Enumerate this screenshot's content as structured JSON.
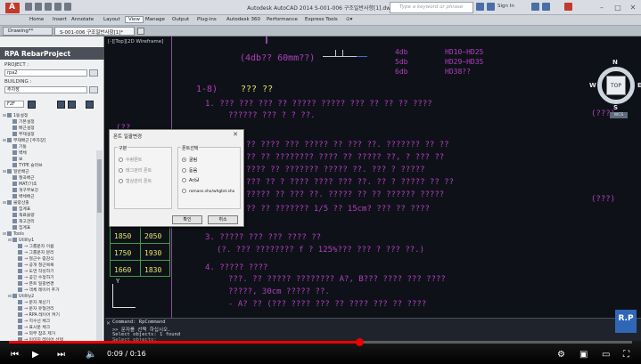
{
  "window": {
    "title": "Autodesk AutoCAD 2014    S-001-006 구조일반사항[1].dwg",
    "search_placeholder": "Type a keyword or phrase",
    "sign_in": "Sign In"
  },
  "ribbon_tabs": [
    "Home",
    "Insert",
    "Annotate",
    "Layout",
    "View",
    "Manage",
    "Output",
    "Plug-ins",
    "Autodesk 360",
    "Performance",
    "Express Tools"
  ],
  "ribbon_active": "View",
  "workspace": "Drawing**",
  "file_tab": "S-001-006 구조일반사항[1]*",
  "palette": {
    "title": "RPA RebarProject",
    "project_label": "PROJECT :",
    "project_value": "rpa2",
    "building_label": "BUILDING :",
    "building_value": "주차장",
    "floor_value": "F2F",
    "tree": [
      {
        "indent": 0,
        "exp": "⊟",
        "label": "1동설정"
      },
      {
        "indent": 1,
        "exp": "",
        "label": "기본설정"
      },
      {
        "indent": 1,
        "exp": "",
        "label": "배근설정"
      },
      {
        "indent": 1,
        "exp": "",
        "label": "부재설정"
      },
      {
        "indent": 0,
        "exp": "⊟",
        "label": "부재배근    [주차장]"
      },
      {
        "indent": 1,
        "exp": "",
        "label": "기둥"
      },
      {
        "indent": 1,
        "exp": "",
        "label": "벽체"
      },
      {
        "indent": 1,
        "exp": "",
        "label": "보"
      },
      {
        "indent": 1,
        "exp": "",
        "label": "TYPE 슬라브"
      },
      {
        "indent": 0,
        "exp": "⊟",
        "label": "일반배근"
      },
      {
        "indent": 1,
        "exp": "",
        "label": "절곡배근"
      },
      {
        "indent": 1,
        "exp": "",
        "label": "MAT/기초"
      },
      {
        "indent": 1,
        "exp": "",
        "label": "개구부보강"
      },
      {
        "indent": 1,
        "exp": "",
        "label": "벽체배근"
      },
      {
        "indent": 0,
        "exp": "⊟",
        "label": "물량산출"
      },
      {
        "indent": 1,
        "exp": "",
        "label": "집계표"
      },
      {
        "indent": 1,
        "exp": "",
        "label": "재료물량"
      },
      {
        "indent": 1,
        "exp": "",
        "label": "재고관리"
      },
      {
        "indent": 1,
        "exp": "",
        "label": "집계표"
      },
      {
        "indent": 0,
        "exp": "⊟",
        "label": "Tools"
      },
      {
        "indent": 1,
        "exp": "⊟",
        "label": "Utility1"
      },
      {
        "indent": 2,
        "exp": "",
        "label": "→ 그룹문자 이름"
      },
      {
        "indent": 2,
        "exp": "",
        "label": "→ 그룹문자 분리"
      },
      {
        "indent": 2,
        "exp": "",
        "label": "→ 철근수 증감식"
      },
      {
        "indent": 2,
        "exp": "",
        "label": "→ 공개 철근목록"
      },
      {
        "indent": 2,
        "exp": "",
        "label": "→ 도면 작성하기"
      },
      {
        "indent": 2,
        "exp": "",
        "label": "→ 공간 수정하기"
      },
      {
        "indent": 2,
        "exp": "",
        "label": "→ 폰트 일괄변경"
      },
      {
        "indent": 2,
        "exp": "",
        "label": "→ 객체 레이어 추가"
      },
      {
        "indent": 1,
        "exp": "⊟",
        "label": "Utility2"
      },
      {
        "indent": 2,
        "exp": "",
        "label": "→ 문자 계산기"
      },
      {
        "indent": 2,
        "exp": "",
        "label": "→ 문자 유형관리"
      },
      {
        "indent": 2,
        "exp": "",
        "label": "→ RPA 레이어 켜기"
      },
      {
        "indent": 2,
        "exp": "",
        "label": "→ 치수선 체크"
      },
      {
        "indent": 2,
        "exp": "",
        "label": "→ 표시문 체크"
      },
      {
        "indent": 2,
        "exp": "",
        "label": "→ 외부 참조 제거"
      },
      {
        "indent": 2,
        "exp": "",
        "label": "→ 이미지 레이어 선택"
      }
    ]
  },
  "viewport_label": "[-][Top][2D Wireframe]",
  "cad_texts": {
    "t1": "(4db?? 60mm??)",
    "t2": "4db",
    "t3": "5db",
    "t4": "6db",
    "t5": "HD10~HD25",
    "t6": "HD29~HD35",
    "t7": "HD38??",
    "t8": "1-8)",
    "t9": "??? ??",
    "t10": "1. ??? ??? ??? ?? ????? ????? ??? ?? ?? ?? ????",
    "t11": "?????? ??? ? ? ??.",
    "t12": "(??",
    "t13": "?? ???? ??? ????? ?? ??? ??.  ??????? ?? ??",
    "t14": "?? ?? ???????? ???? ?? ?????  ??, ? ??? ??",
    "t15": "???? ?? ??????? ????? ??.  ??? ? ?????",
    "t16": "??? ?? ? ???? ???? ??? ??.  ?? ? ????? ?? ??",
    "t17": "????? ?? ??? ??. ????? ?? ?? ?????? ?????",
    "t18": "?? ?? ??????? 1/5  ?? 15cm? ??? ?? ????",
    "t19": "3. ????? ??? ??? ???? ??",
    "t20": "(?. ??? ???????? f ? 125%??? ??? ? ??? ??.)",
    "t21": "4. ????? ????",
    "t22": "???. ?? ????? ???????? A?, B??? ???? ??? ????",
    "t23": "?????, 30cm ????? ??.",
    "t24": "- A? ?? (??? ???? ??? ?? ???? ??? ?? ????",
    "side1": "(???)",
    "side2": "(???)"
  },
  "table_rows": [
    [
      "1850",
      "2050"
    ],
    [
      "1750",
      "1930"
    ],
    [
      "1660",
      "1830"
    ]
  ],
  "dialog": {
    "title": "폰트 일괄변경",
    "group1_title": "구분",
    "group1_options": [
      "수량폰트",
      "태그관리 폰트",
      "형상관리 폰트"
    ],
    "group2_title": "폰트선택",
    "group2_options": [
      "굴림",
      "돋움",
      "Arial",
      "romans.shx/whgtxt.shx"
    ],
    "group2_selected": 0,
    "ok": "확인",
    "cancel": "취소"
  },
  "viewcube": {
    "north": "N",
    "west": "W",
    "east": "E",
    "south": "S",
    "face": "TOP",
    "wcs": "WCS"
  },
  "command": {
    "line1": "Command: RpCommand",
    "line2": ">> 문자를 선택 하십시오.",
    "line3": "Select objects: 1 found",
    "line4": "Select objects:"
  },
  "badge": "R.P",
  "video": {
    "time": "0:09 / 0:16",
    "progress": 0.5625
  }
}
